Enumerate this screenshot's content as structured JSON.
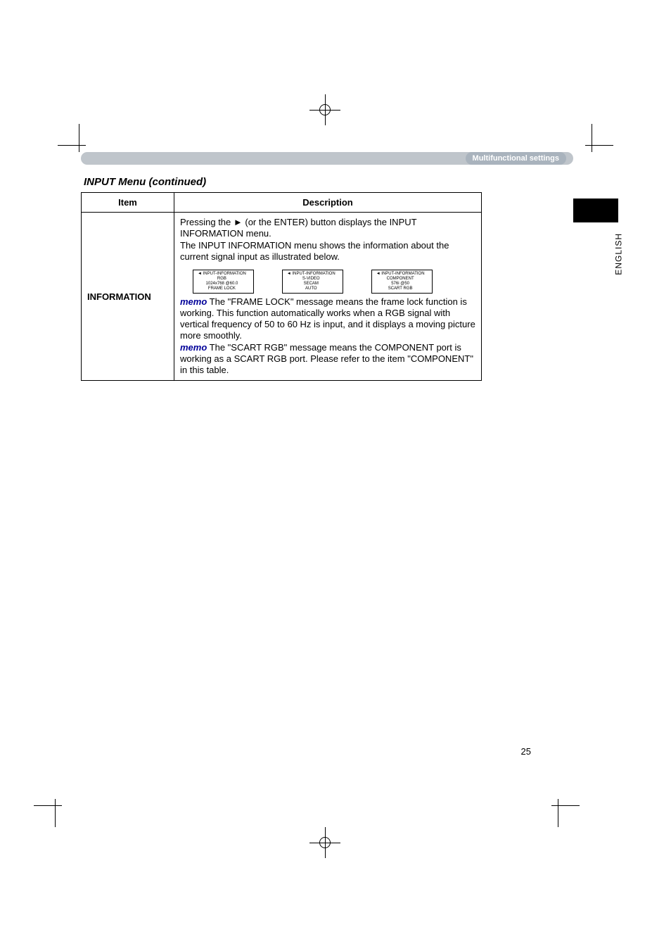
{
  "header": {
    "section": "Multifunctional settings"
  },
  "title": "INPUT Menu (continued)",
  "side_label": "ENGLISH",
  "table": {
    "col_item": "Item",
    "col_desc": "Description",
    "row_label": "INFORMATION",
    "p1a": "Pressing the ",
    "p1_btn": "►",
    "p1b": " (or the ENTER) button displays the INPUT INFORMATION menu.",
    "p2": "The INPUT INFORMATION menu shows the information about the current signal input as illustrated below.",
    "memo_label": "memo",
    "m1": " The \"FRAME LOCK\" message means the frame lock function is working. This function automatically works when a RGB signal with vertical frequency of 50 to 60 Hz is input, and it displays a moving picture more smoothly.",
    "m2": " The \"SCART RGB\" message means the COMPONENT port is working as a SCART RGB port. Please refer to the item \"COMPONENT\" in this table."
  },
  "illus": {
    "hdr_prefix": "◄",
    "hdr": " INPUT-INFORMATION",
    "a": {
      "l1": "RGB",
      "l2": "1024x768 @60.0",
      "l3": "FRAME LOCK"
    },
    "b": {
      "l1": "S-VIDEO",
      "l2": "SECAM",
      "l3": "AUTO"
    },
    "c": {
      "l1": "COMPONENT",
      "l2": "576i @50",
      "l3": "SCART RGB"
    }
  },
  "page_number": "25"
}
